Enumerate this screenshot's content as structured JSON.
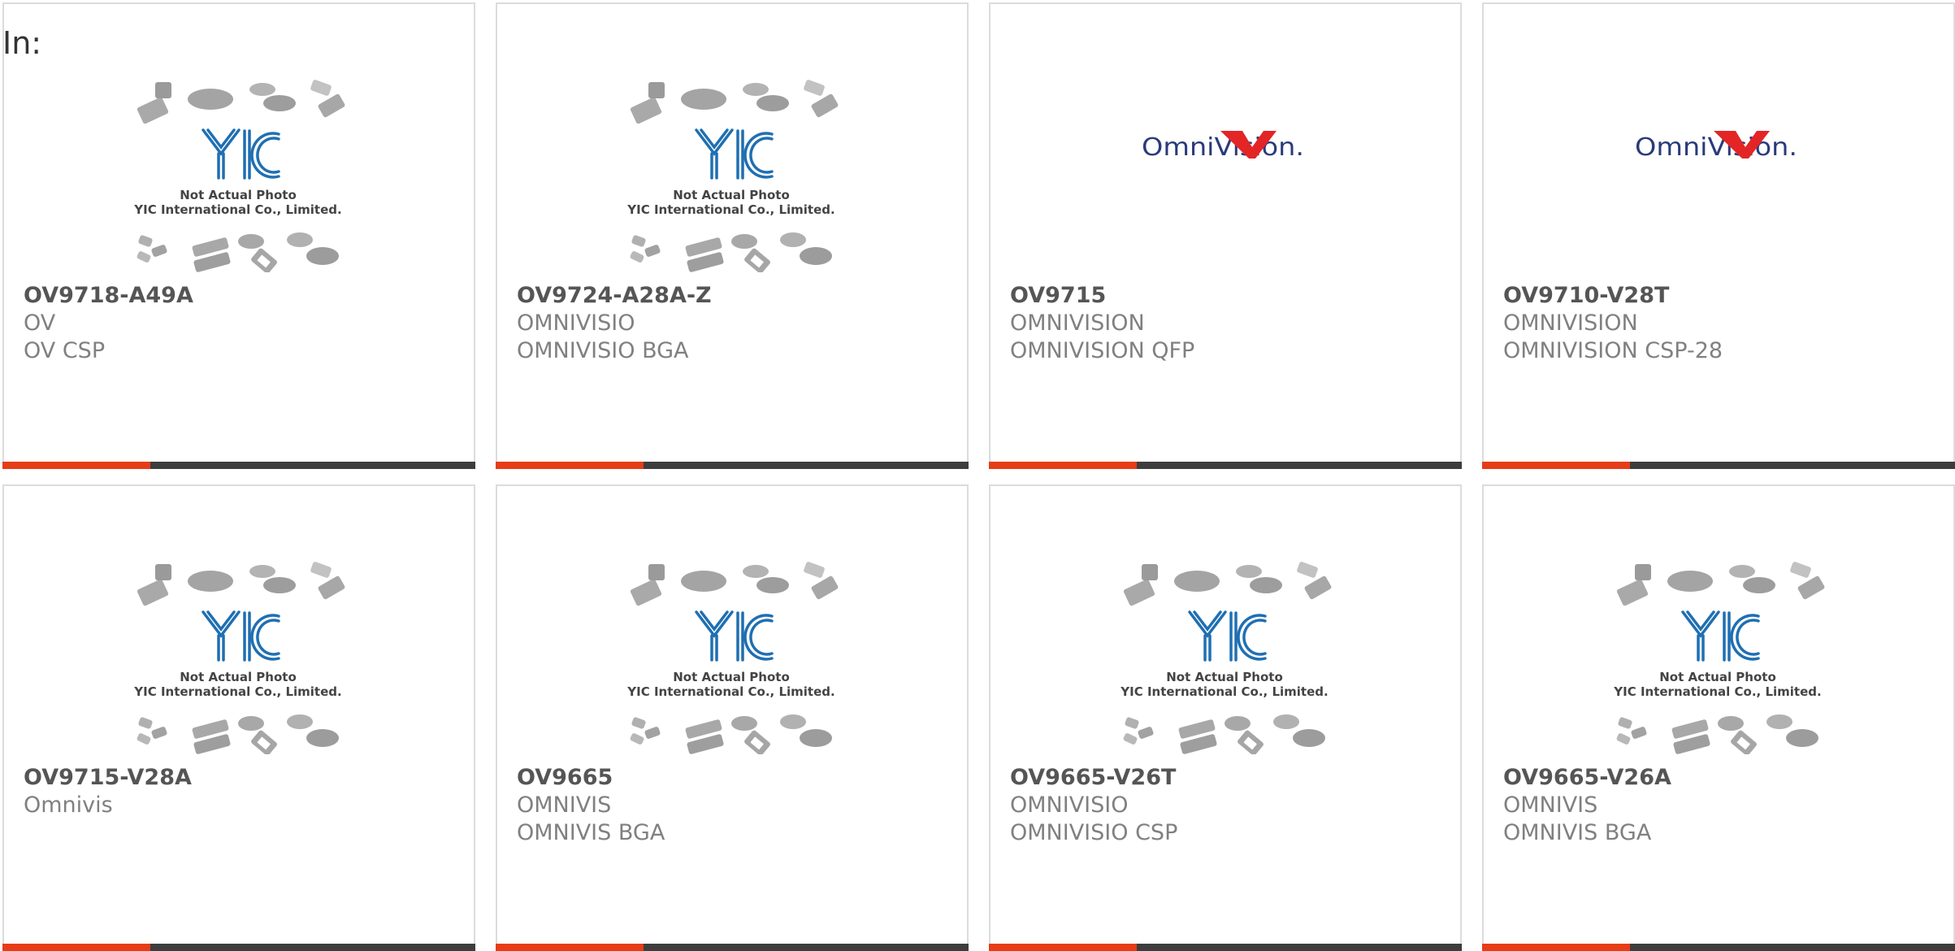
{
  "header": {
    "label": "In:"
  },
  "placeholder_image": {
    "line1": "Not Actual Photo",
    "line2": "YIC International Co., Limited."
  },
  "brand_logo": {
    "text": "OmniVision."
  },
  "colors": {
    "accent": "#e63c17",
    "bar_dark": "#3d3d3d",
    "yic_blue": "#1f6fb2",
    "omni_blue": "#2a3b7a",
    "omni_red": "#e32526"
  },
  "products": [
    {
      "part": "OV9718-A49A",
      "manufacturer": "OV",
      "package": "OV CSP",
      "image": "yic-placeholder"
    },
    {
      "part": "OV9724-A28A-Z",
      "manufacturer": "OMNIVISIO",
      "package": "OMNIVISIO BGA",
      "image": "yic-placeholder"
    },
    {
      "part": "OV9715",
      "manufacturer": "OMNIVISION",
      "package": "OMNIVISION QFP",
      "image": "omnivision-logo"
    },
    {
      "part": "OV9710-V28T",
      "manufacturer": "OMNIVISION",
      "package": "OMNIVISION CSP-28",
      "image": "omnivision-logo"
    },
    {
      "part": "OV9715-V28A",
      "manufacturer": "Omnivis",
      "package": "",
      "image": "yic-placeholder"
    },
    {
      "part": "OV9665",
      "manufacturer": "OMNIVIS",
      "package": "OMNIVIS BGA",
      "image": "yic-placeholder"
    },
    {
      "part": "OV9665-V26T",
      "manufacturer": "OMNIVISIO",
      "package": "OMNIVISIO CSP",
      "image": "yic-placeholder"
    },
    {
      "part": "OV9665-V26A",
      "manufacturer": "OMNIVIS",
      "package": "OMNIVIS BGA",
      "image": "yic-placeholder"
    }
  ]
}
